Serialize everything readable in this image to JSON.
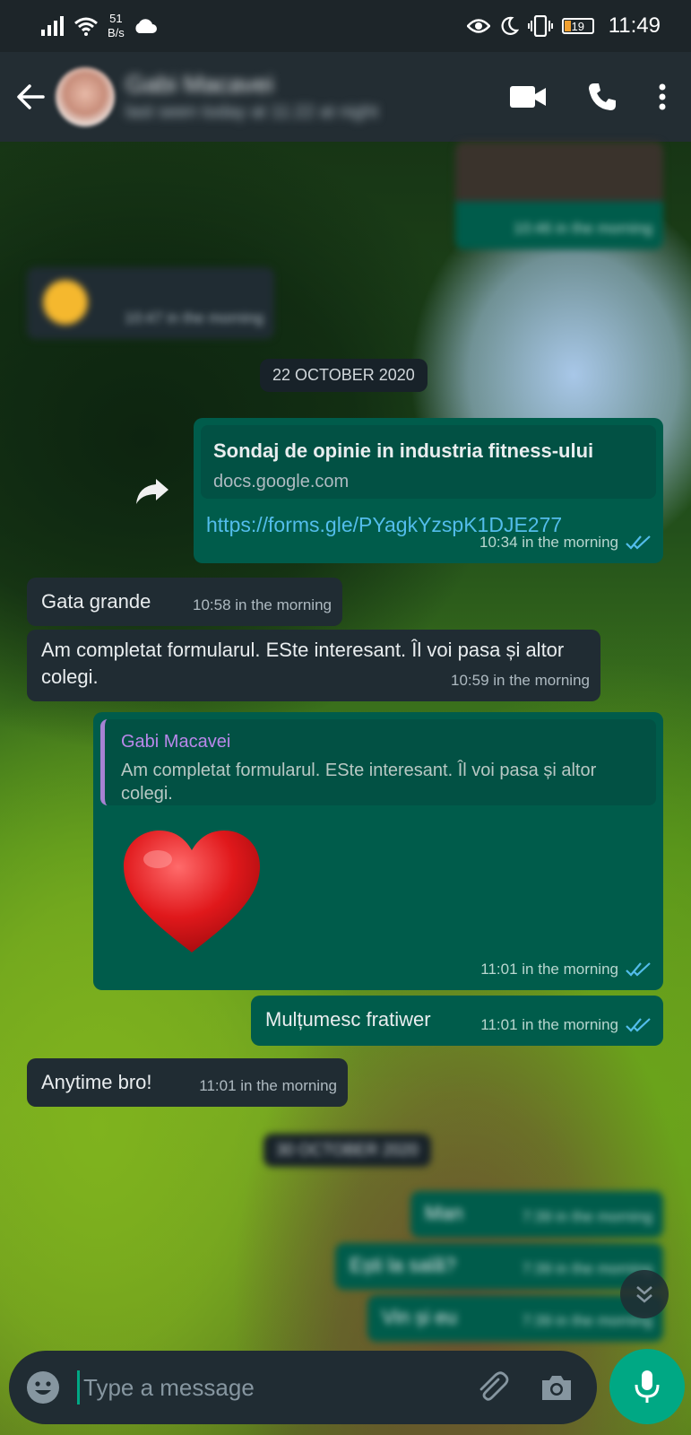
{
  "status_bar": {
    "net_speed_value": "51",
    "net_speed_unit": "B/s",
    "battery": "19",
    "time": "11:49"
  },
  "header": {
    "contact_name": "Gabi Macavei",
    "contact_status": "last seen today at 11:22 at night"
  },
  "messages": {
    "m1_time": "10:46 in the morning",
    "m2_time": "10:47 in the morning",
    "date_chip_1": "22 OCTOBER 2020",
    "link": {
      "title": "Sondaj de opinie in industria fitness-ului",
      "domain": "docs.google.com",
      "url": "https://forms.gle/PYagkYzspK1DJE277",
      "time": "10:34 in the morning"
    },
    "gata": {
      "text": "Gata grande",
      "time": "10:58 in the morning"
    },
    "am_completat": {
      "text": "Am completat formularul. ESte interesant. Îl voi pasa și altor colegi.",
      "time": "10:59 in the morning"
    },
    "reply": {
      "quote_name": "Gabi Macavei",
      "quote_text": "Am completat formularul. ESte interesant. Îl voi pasa și altor colegi.",
      "time": "11:01 in the morning"
    },
    "multumesc": {
      "text": "Mulțumesc fratiwer",
      "time": "11:01 in the morning"
    },
    "anytime": {
      "text": "Anytime bro!",
      "time": "11:01 in the morning"
    },
    "date_chip_2": "30 OCTOBER 2020",
    "man": {
      "text": "Man",
      "time": "7:39 in the morning"
    },
    "esti": {
      "text": "Ești la sală?",
      "time": "7:39 in the morning"
    },
    "vin": {
      "text": "Vin și eu",
      "time": "7:39 in the morning"
    }
  },
  "input": {
    "placeholder": "Type a message"
  },
  "colors": {
    "incoming": "#202c33",
    "outgoing": "#005c4b",
    "accent": "#00a884",
    "read_ticks": "#53bdeb"
  }
}
